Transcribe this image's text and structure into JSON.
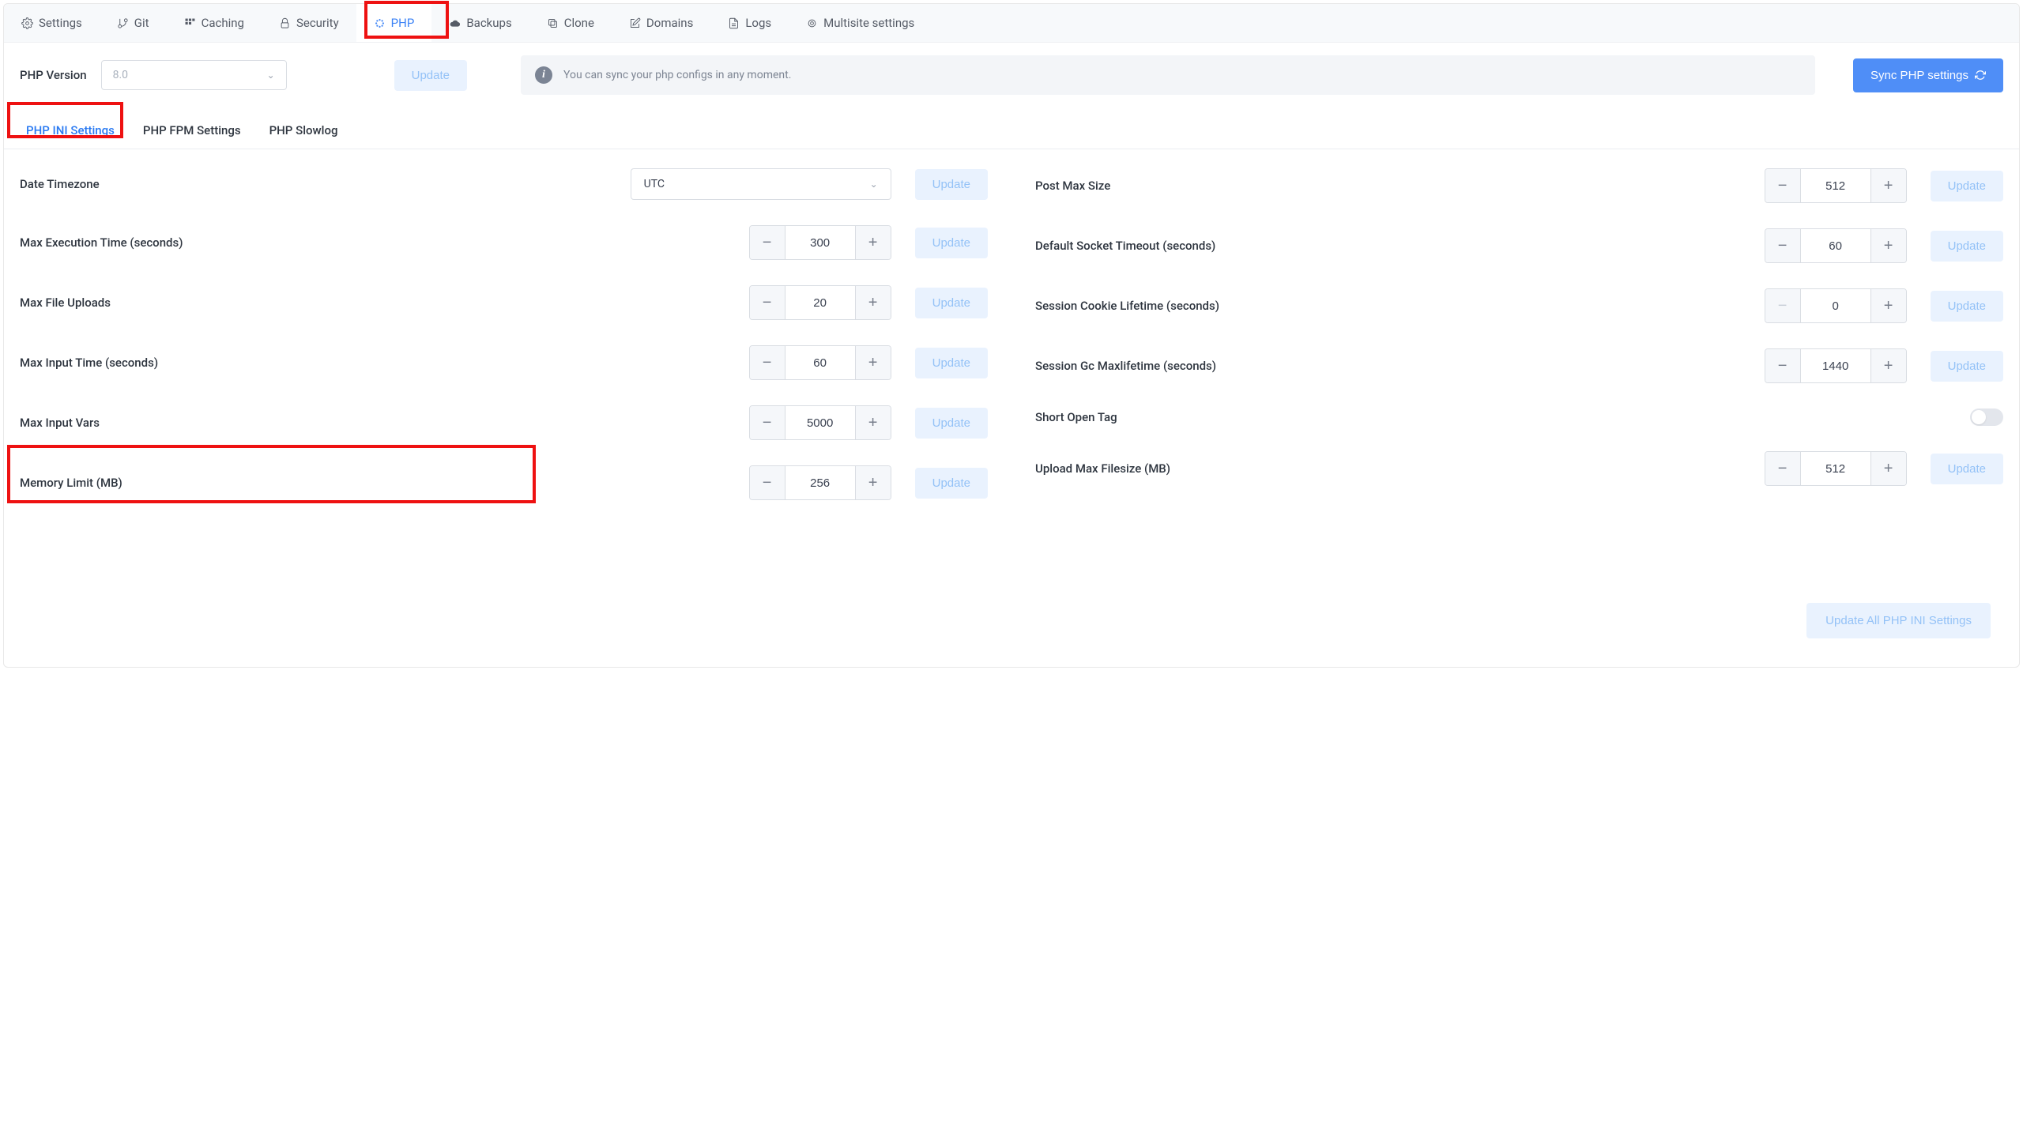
{
  "topTabs": {
    "settings": "Settings",
    "git": "Git",
    "caching": "Caching",
    "security": "Security",
    "php": "PHP",
    "backups": "Backups",
    "clone": "Clone",
    "domains": "Domains",
    "logs": "Logs",
    "multisite": "Multisite settings"
  },
  "version": {
    "label": "PHP Version",
    "value": "8.0",
    "updateLabel": "Update"
  },
  "infoText": "You can sync your php configs in any moment.",
  "syncLabel": "Sync PHP settings",
  "subTabs": {
    "ini": "PHP INI Settings",
    "fpm": "PHP FPM Settings",
    "slowlog": "PHP Slowlog"
  },
  "left": {
    "timezone": {
      "label": "Date Timezone",
      "value": "UTC",
      "update": "Update"
    },
    "maxExec": {
      "label": "Max Execution Time (seconds)",
      "value": "300",
      "update": "Update"
    },
    "maxFileUploads": {
      "label": "Max File Uploads",
      "value": "20",
      "update": "Update"
    },
    "maxInputTime": {
      "label": "Max Input Time (seconds)",
      "value": "60",
      "update": "Update"
    },
    "maxInputVars": {
      "label": "Max Input Vars",
      "value": "5000",
      "update": "Update"
    },
    "memoryLimit": {
      "label": "Memory Limit (MB)",
      "value": "256",
      "update": "Update"
    }
  },
  "right": {
    "postMaxSize": {
      "label": "Post Max Size",
      "value": "512",
      "update": "Update"
    },
    "defaultSocketTimeout": {
      "label": "Default Socket Timeout (seconds)",
      "value": "60",
      "update": "Update"
    },
    "sessionCookieLifetime": {
      "label": "Session Cookie Lifetime (seconds)",
      "value": "0",
      "update": "Update",
      "minusDisabled": true
    },
    "sessionGcMax": {
      "label": "Session Gc Maxlifetime (seconds)",
      "value": "1440",
      "update": "Update"
    },
    "shortOpenTag": {
      "label": "Short Open Tag"
    },
    "uploadMaxFilesize": {
      "label": "Upload Max Filesize (MB)",
      "value": "512",
      "update": "Update"
    }
  },
  "updateAll": "Update All PHP INI Settings"
}
